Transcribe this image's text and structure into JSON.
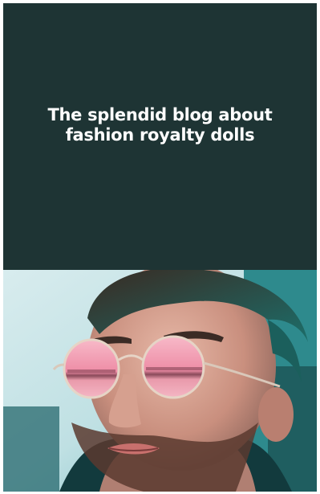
{
  "hero": {
    "title_line1": "The splendid blog about",
    "title_line2": "fashion royalty dolls",
    "background_color": "#1e3434",
    "text_color": "#ffffff"
  },
  "photo": {
    "subject": "man-with-round-pink-mirrored-sunglasses",
    "icon_name": "portrait-photo"
  }
}
